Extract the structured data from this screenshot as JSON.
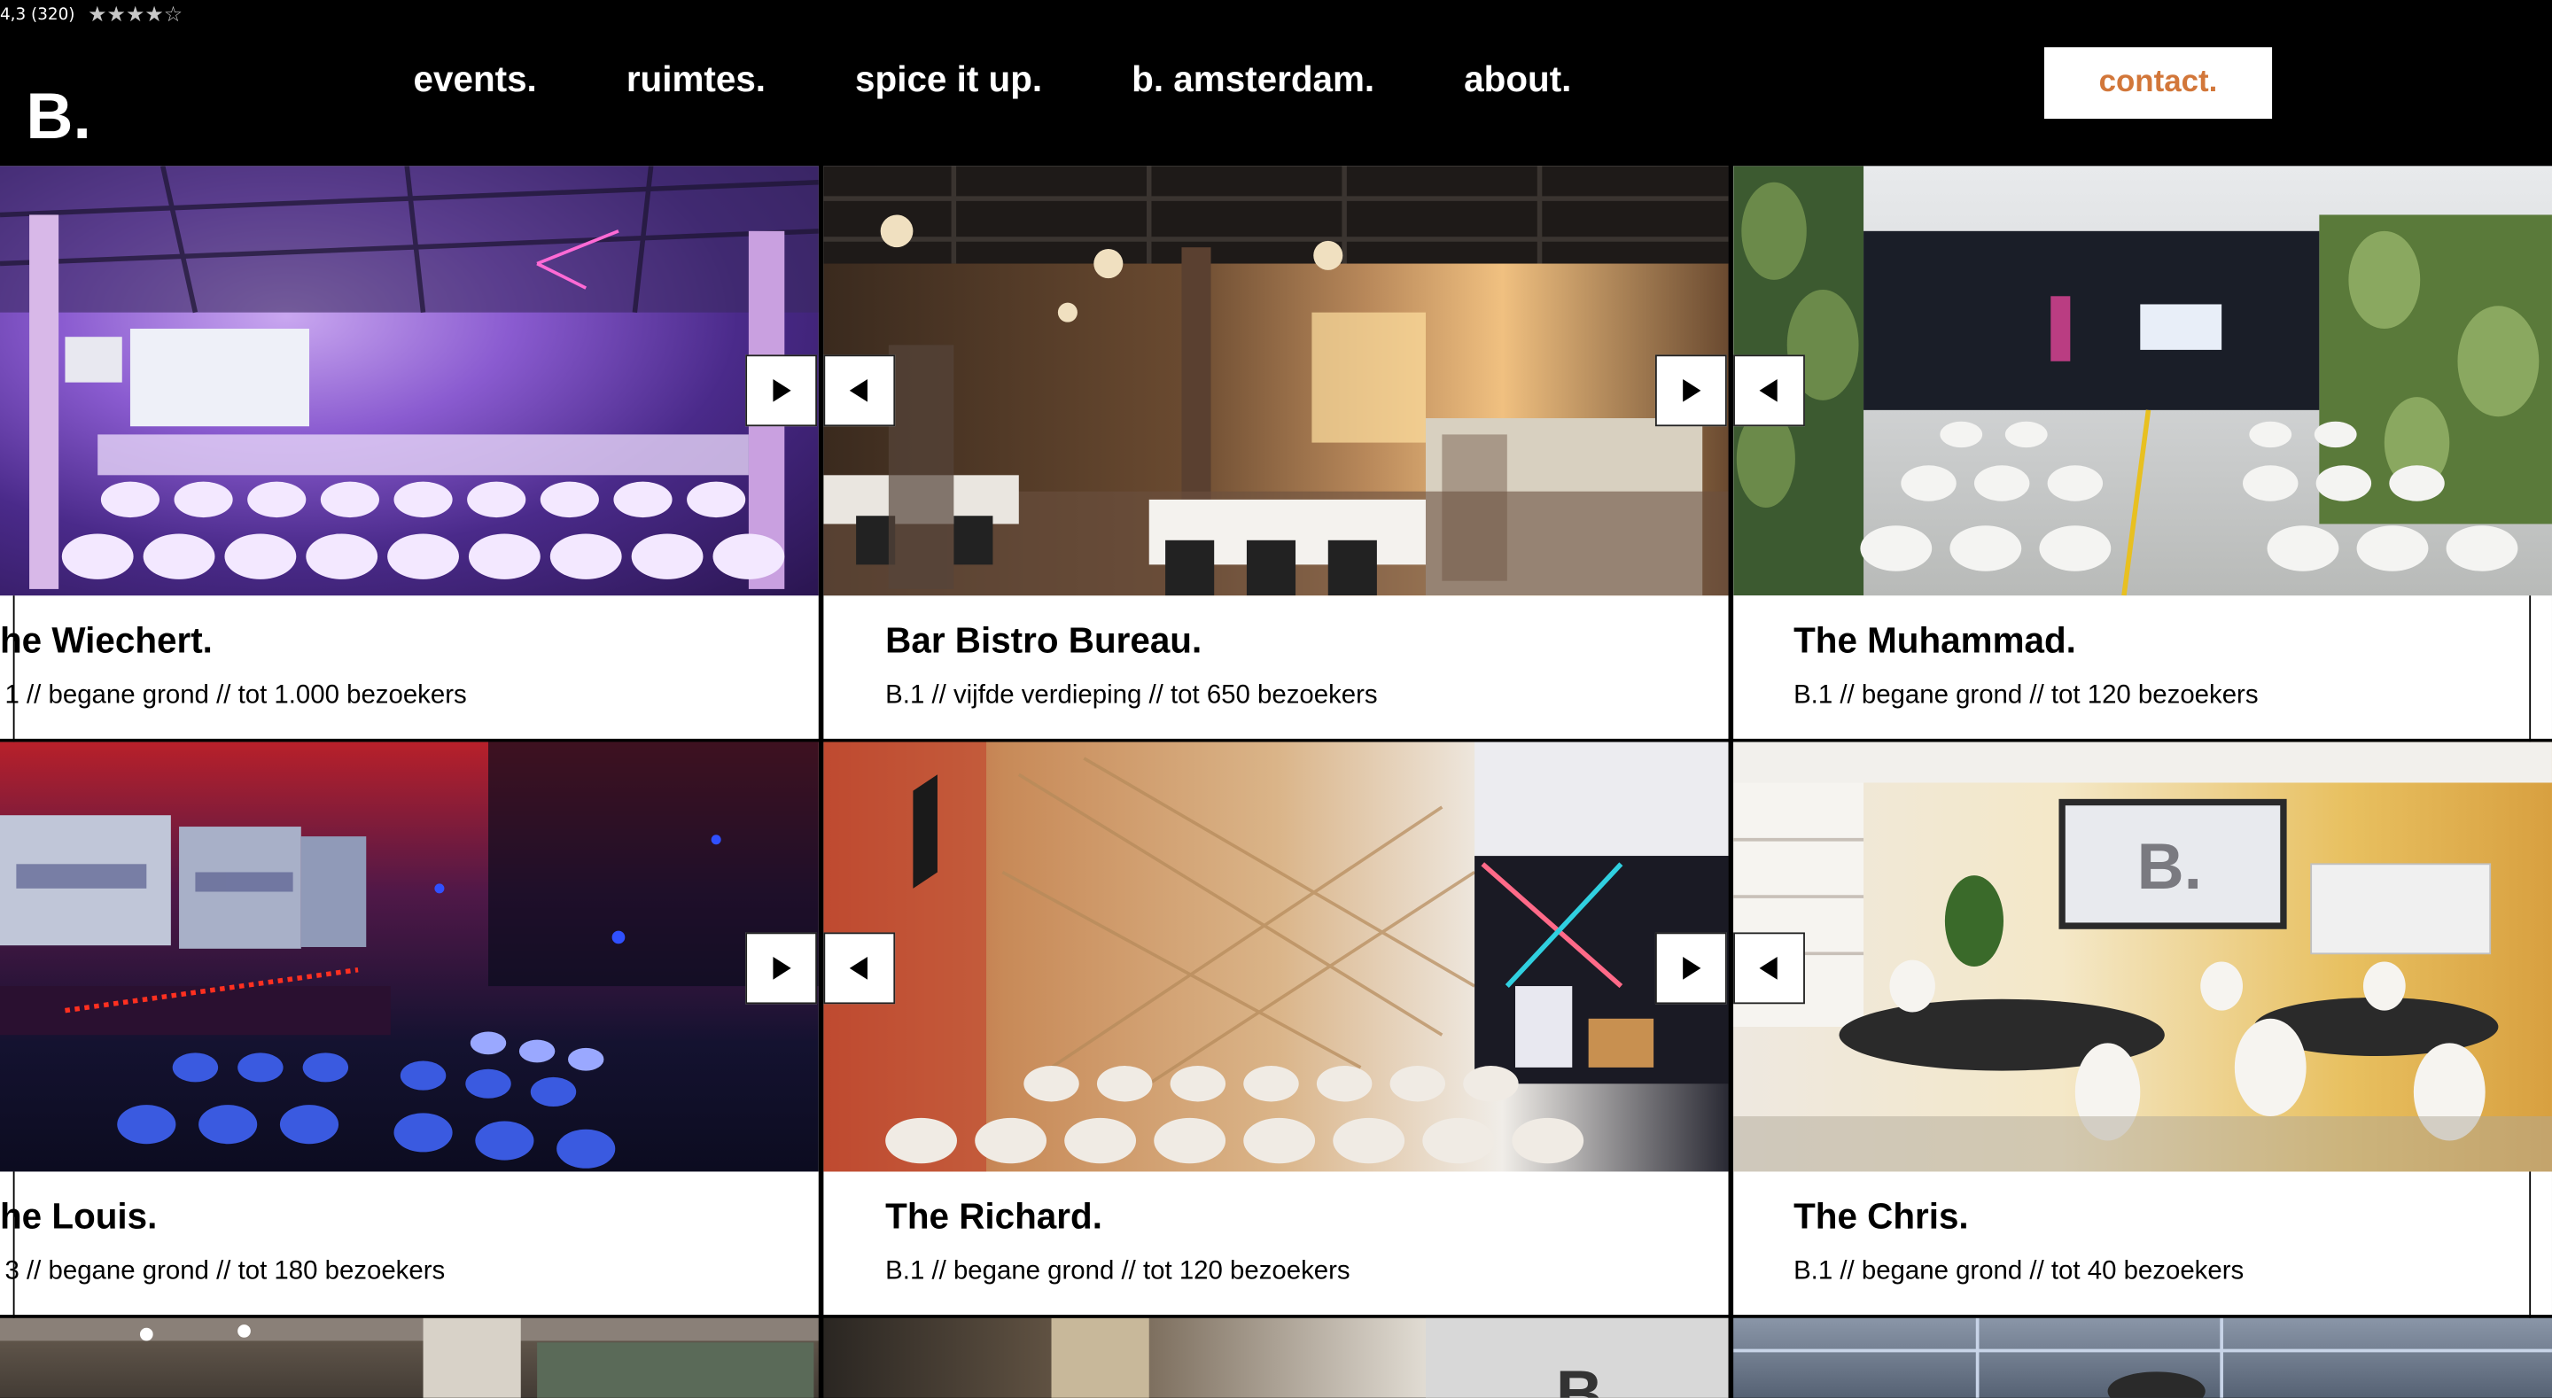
{
  "rating": {
    "text": "4,3 (320)",
    "stars": "★★★★☆"
  },
  "logo": "B.",
  "nav": [
    "events.",
    "ruimtes.",
    "spice it up.",
    "b. amsterdam.",
    "about."
  ],
  "contact": "contact.",
  "cards": [
    {
      "title": "he Wiechert.",
      "sub": "1 // begane grond // tot 1.000 bezoekers"
    },
    {
      "title": "Bar Bistro Bureau.",
      "sub": "B.1 // vijfde verdieping // tot 650 bezoekers"
    },
    {
      "title": "The Muhammad.",
      "sub": "B.1 // begane grond // tot 120 bezoekers"
    },
    {
      "title": "he Louis.",
      "sub": "3 // begane grond // tot 180 bezoekers"
    },
    {
      "title": "The Richard.",
      "sub": "B.1 // begane grond // tot 120 bezoekers"
    },
    {
      "title": "The Chris.",
      "sub": "B.1 // begane grond // tot 40 bezoekers"
    }
  ],
  "colors": {
    "accent": "#d2773a",
    "background": "#000000"
  },
  "icons": {
    "next": "play-right-icon",
    "prev": "play-left-icon"
  }
}
